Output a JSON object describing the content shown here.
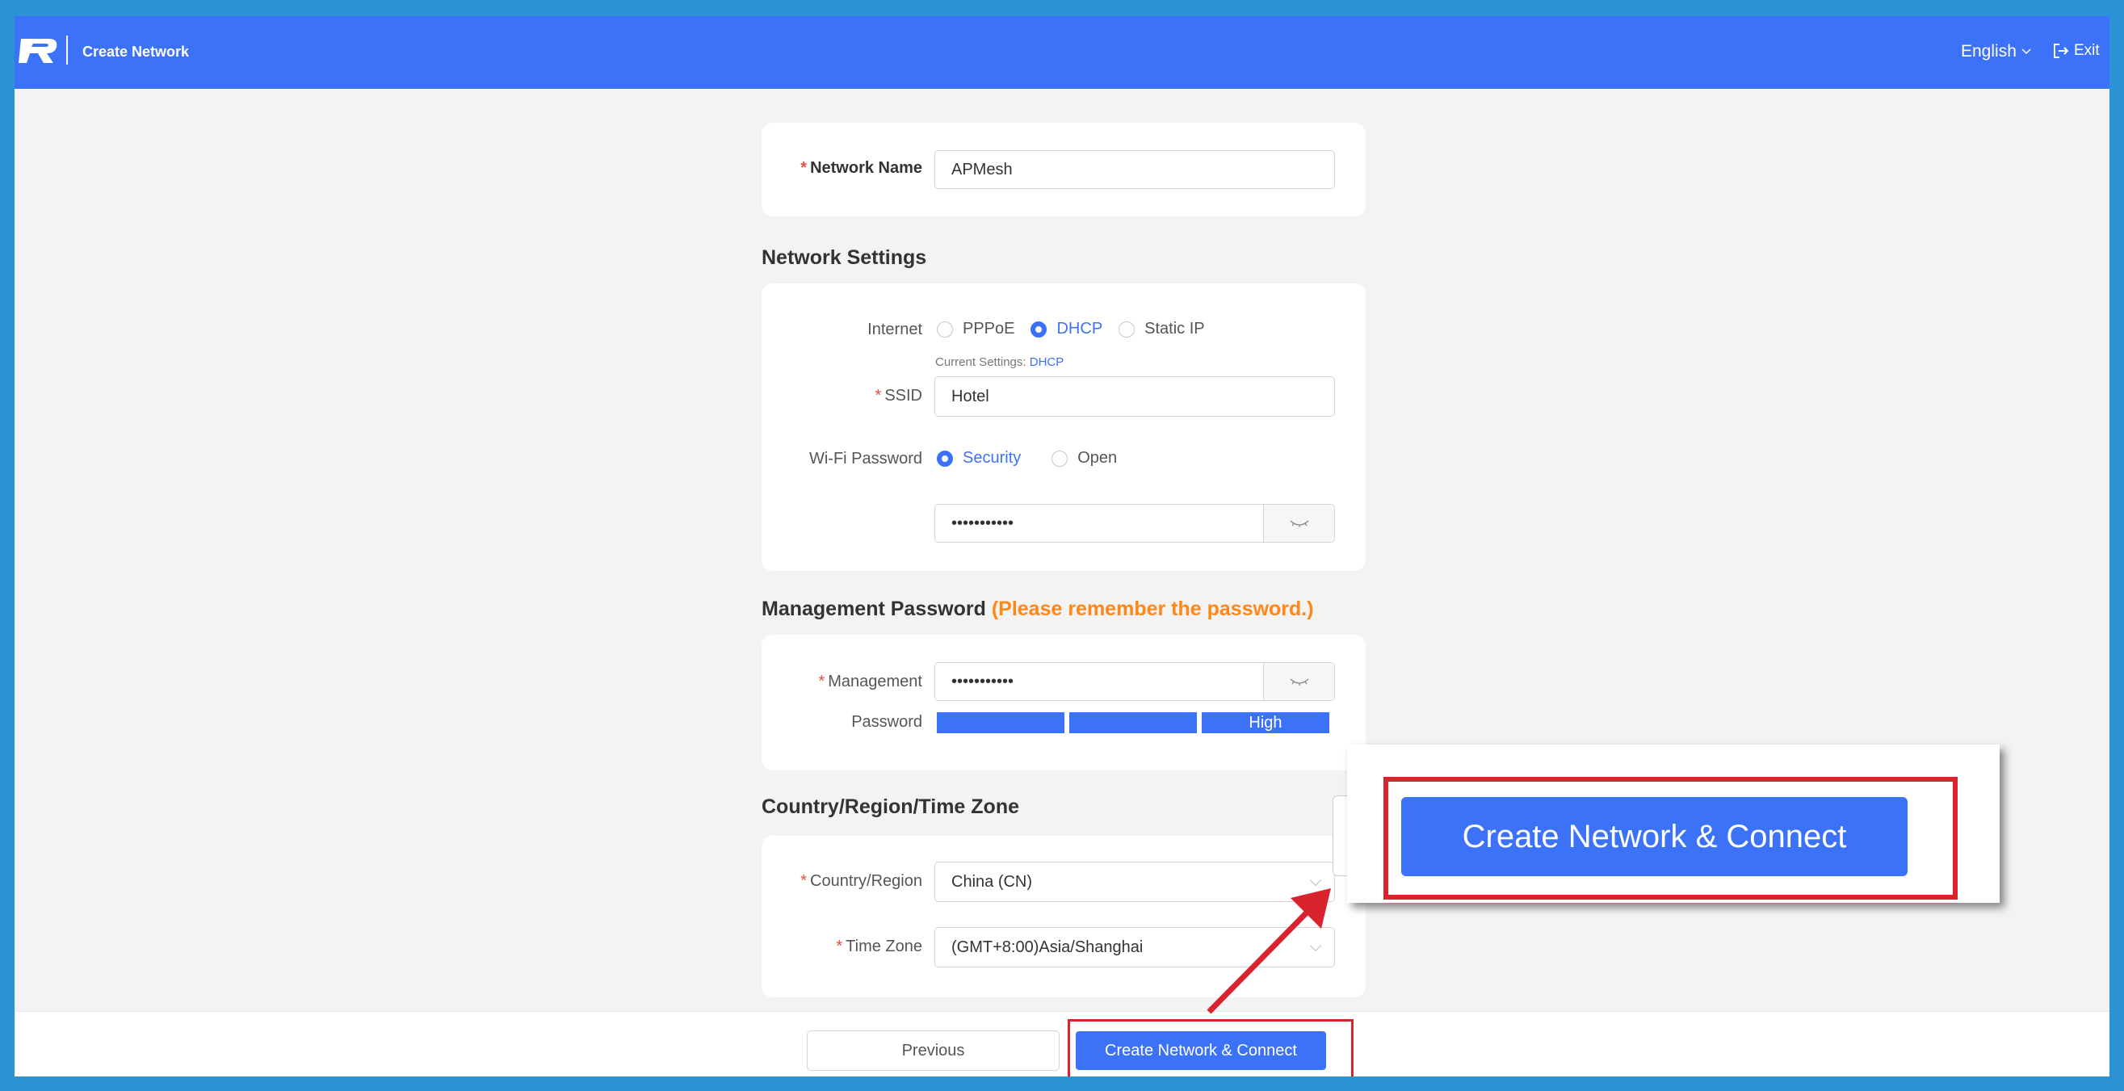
{
  "header": {
    "title": "Create Network",
    "language": "English",
    "exit_label": "Exit"
  },
  "network_name": {
    "label": "Network Name",
    "value": "APMesh"
  },
  "network_settings": {
    "heading": "Network Settings",
    "internet_label": "Internet",
    "internet_options": [
      "PPPoE",
      "DHCP",
      "Static IP"
    ],
    "internet_selected": "DHCP",
    "current_settings_label": "Current Settings:",
    "current_settings_value": "DHCP",
    "ssid_label": "SSID",
    "ssid_value": "Hotel",
    "wifi_password_label": "Wi-Fi Password",
    "wifi_password_options": [
      "Security",
      "Open"
    ],
    "wifi_password_selected": "Security",
    "wifi_password_value": "•••••••••••"
  },
  "management": {
    "heading": "Management Password",
    "heading_note": "(Please remember the password.)",
    "label_line1": "Management",
    "label_line2": "Password",
    "password_value": "•••••••••••",
    "strength_label": "High",
    "strength_level": "3 of 3"
  },
  "region": {
    "heading": "Country/Region/Time Zone",
    "country_label": "Country/Region",
    "country_value": "China (CN)",
    "timezone_label": "Time Zone",
    "timezone_value": "(GMT+8:00)Asia/Shanghai"
  },
  "footer": {
    "previous_label": "Previous",
    "create_label": "Create Network & Connect"
  },
  "callout": {
    "button_label": "Create Network & Connect"
  },
  "colors": {
    "brand": "#3c72f7",
    "highlight": "#d9232d",
    "warning": "#ff8717",
    "frame": "#2b92d6"
  }
}
